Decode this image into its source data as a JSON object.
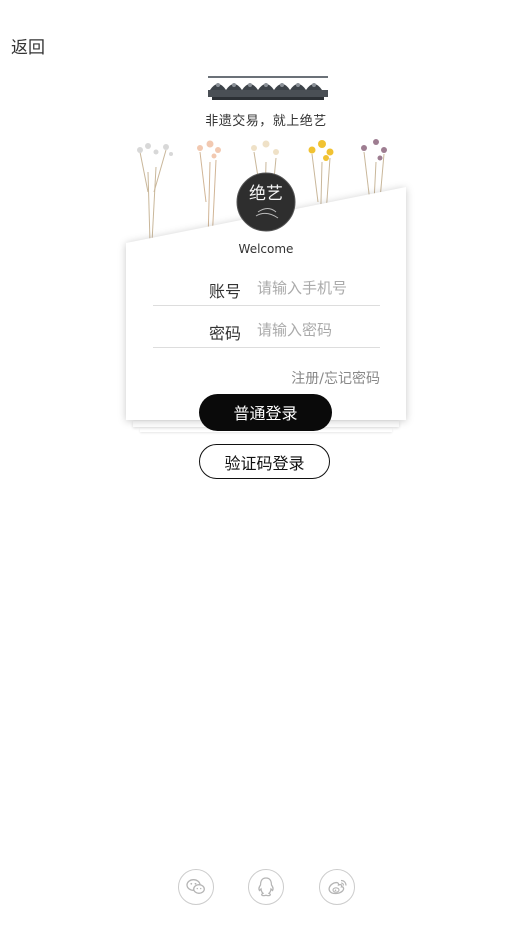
{
  "nav": {
    "back_label": "返回"
  },
  "header": {
    "slogan": "非遗交易，就上绝艺"
  },
  "brand": {
    "logo_text": "绝艺"
  },
  "login": {
    "welcome": "Welcome",
    "account_label": "账号",
    "account_placeholder": "请输入手机号",
    "password_label": "密码",
    "password_placeholder": "请输入密码",
    "register_forgot": "注册/忘记密码",
    "normal_login_button": "普通登录",
    "code_login_button": "验证码登录"
  },
  "social": {
    "icons": [
      "wechat-icon",
      "qq-icon",
      "weibo-icon"
    ]
  },
  "colors": {
    "primary_button": "#0a0a0a",
    "placeholder": "#aaaaaa",
    "link": "#888888"
  }
}
